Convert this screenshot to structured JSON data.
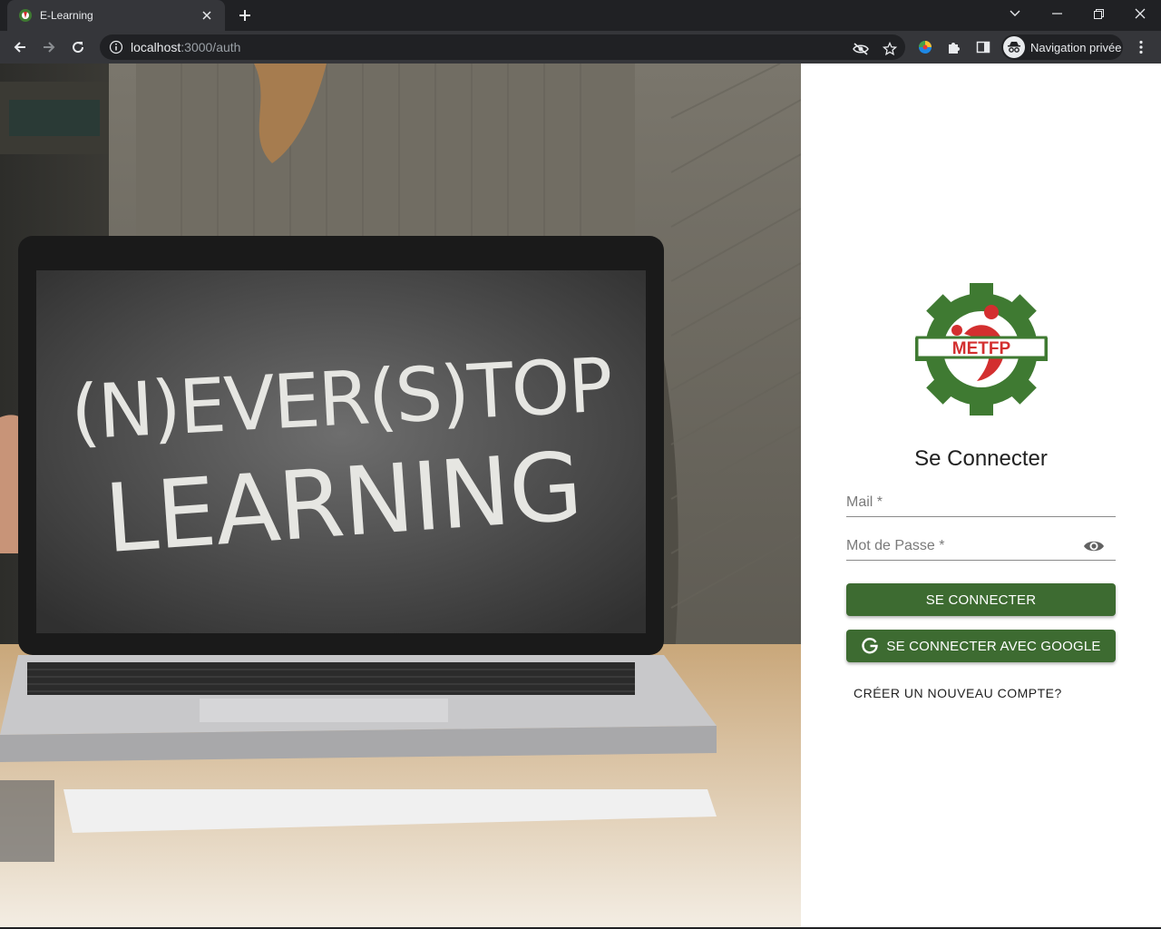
{
  "browser": {
    "tab_title": "E-Learning",
    "url_host": "localhost",
    "url_path": ":3000/auth",
    "profile_label": "Navigation privée"
  },
  "hero": {
    "line1": "(N)EVER(S)TOP",
    "line2": "LEARNING"
  },
  "login": {
    "logo_text": "METFP",
    "title": "Se Connecter",
    "email_label": "Mail *",
    "password_label": "Mot de Passe *",
    "submit_label": "SE CONNECTER",
    "google_label": "SE CONNECTER AVEC GOOGLE",
    "create_account_label": "CRÉER UN NOUVEAU COMPTE?"
  },
  "colors": {
    "primary": "#3d6b31",
    "logo_green": "#3f7a32",
    "logo_red": "#d32f2f"
  }
}
